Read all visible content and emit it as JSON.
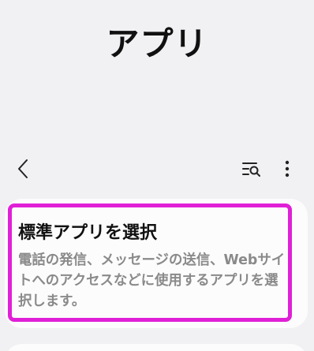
{
  "header": {
    "title": "アプリ"
  },
  "toolbar": {
    "back_icon": "chevron-left-icon",
    "search_icon": "list-search-icon",
    "more_icon": "more-vertical-icon"
  },
  "default_apps": {
    "title": "標準アプリを選択",
    "description": "電話の発信、メッセージの送信、Webサイトへのアクセスなどに使用するアプリを選択します。",
    "highlight_color": "#e020d6"
  }
}
